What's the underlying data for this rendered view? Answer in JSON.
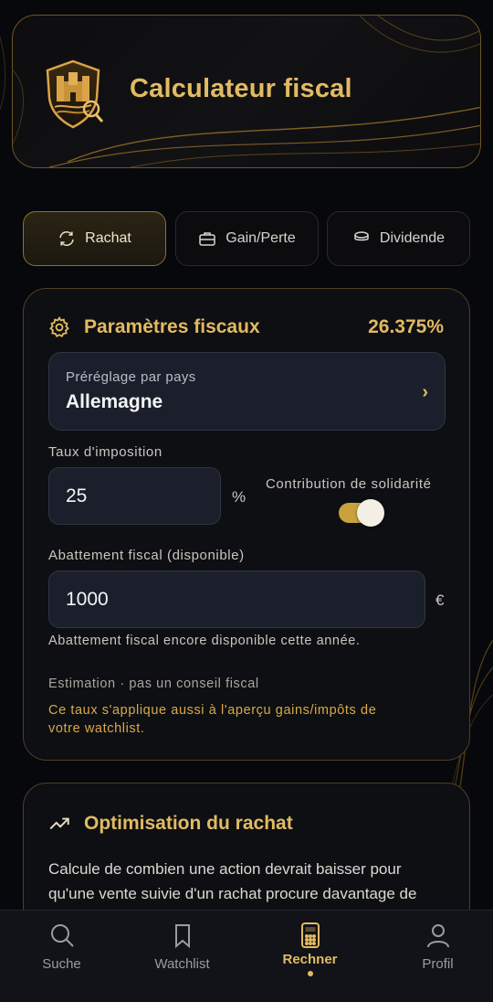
{
  "header": {
    "title": "Calculateur fiscal"
  },
  "tabs": [
    {
      "label": "Rachat",
      "active": true
    },
    {
      "label": "Gain/Perte",
      "active": false
    },
    {
      "label": "Dividende",
      "active": false
    }
  ],
  "params": {
    "title": "Paramètres fiscaux",
    "rate": "26.375%",
    "preset_label": "Préréglage par pays",
    "preset_value": "Allemagne",
    "tax_rate_label": "Taux d'imposition",
    "tax_rate_value": "25",
    "tax_rate_unit": "%",
    "solidarity_label": "Contribution de solidarité",
    "solidarity_enabled": true,
    "allowance_label": "Abattement fiscal (disponible)",
    "allowance_value": "1000",
    "allowance_unit": "€",
    "allowance_hint": "Abattement fiscal encore disponible cette année.",
    "estimate_note": "Estimation · pas un conseil fiscal",
    "watchlist_note_line1": "Ce taux s'applique aussi à l'aperçu gains/impôts de",
    "watchlist_note_line2": "votre watchlist."
  },
  "optimisation": {
    "title": "Optimisation du rachat",
    "text_line1": "Calcule de combien une action devrait baisser pour",
    "text_line2": "qu'une vente suivie d'un rachat procure davantage de"
  },
  "nav": [
    {
      "label": "Suche",
      "icon": "search-icon",
      "active": false
    },
    {
      "label": "Watchlist",
      "icon": "bookmark-icon",
      "active": false
    },
    {
      "label": "Rechner",
      "icon": "calculator-icon",
      "active": true
    },
    {
      "label": "Profil",
      "icon": "person-icon",
      "active": false
    }
  ],
  "colors": {
    "accent": "#e2ba62",
    "background": "#07080b",
    "field": "#1a1f2b",
    "border_gold": "#6b5526"
  }
}
